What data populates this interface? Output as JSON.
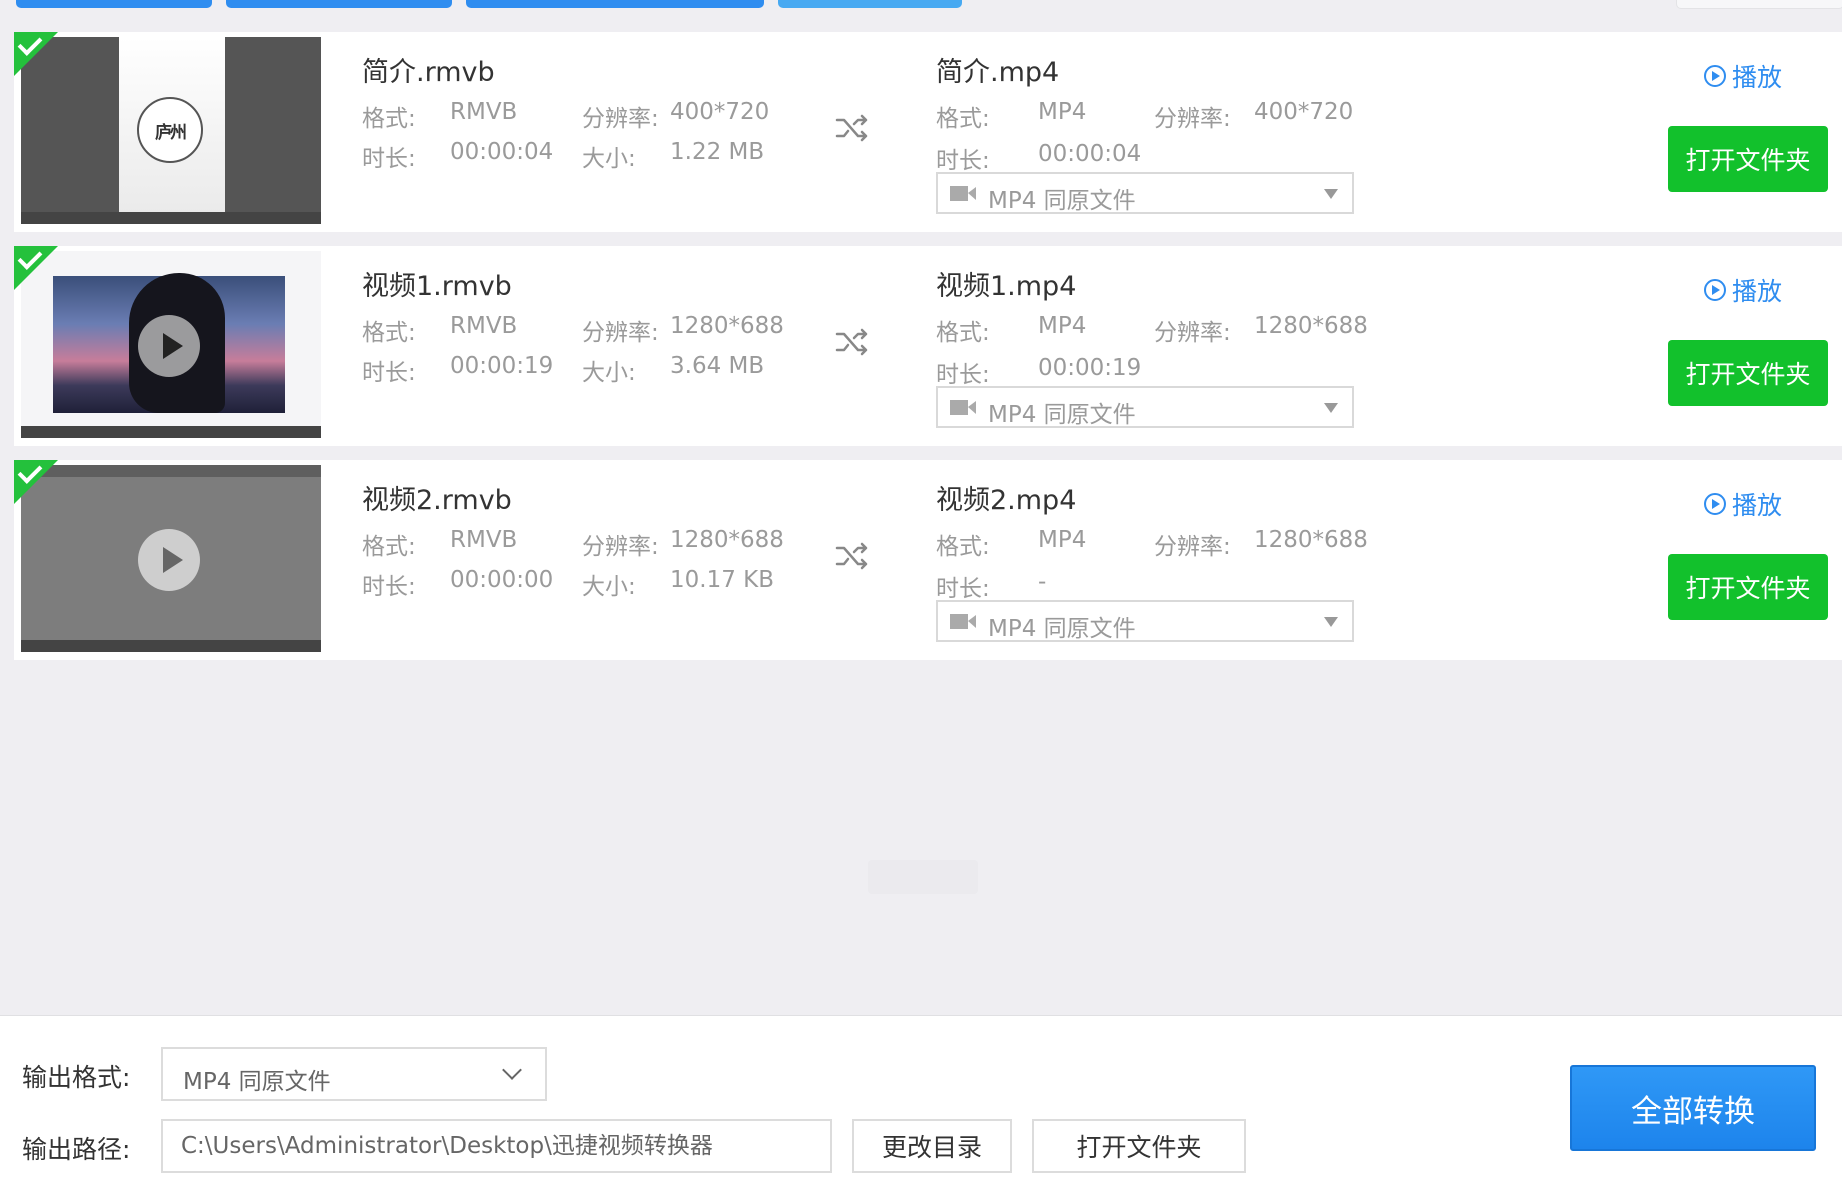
{
  "files": [
    {
      "source_name": "简介.rmvb",
      "format_label": "格式:",
      "source_format": "RMVB",
      "resolution_label": "分辨率:",
      "source_resolution": "400*720",
      "duration_label": "时长:",
      "source_duration": "00:00:04",
      "size_label": "大小:",
      "source_size": "1.22 MB",
      "thumb_text": "庐州",
      "target_name": "简介.mp4",
      "target_format": "MP4",
      "target_resolution": "400*720",
      "target_duration": "00:00:04",
      "output_format": "MP4  同原文件",
      "play_label": "播放",
      "open_folder_label": "打开文件夹"
    },
    {
      "source_name": "视频1.rmvb",
      "format_label": "格式:",
      "source_format": "RMVB",
      "resolution_label": "分辨率:",
      "source_resolution": "1280*688",
      "duration_label": "时长:",
      "source_duration": "00:00:19",
      "size_label": "大小:",
      "source_size": "3.64 MB",
      "target_name": "视频1.mp4",
      "target_format": "MP4",
      "target_resolution": "1280*688",
      "target_duration": "00:00:19",
      "output_format": "MP4  同原文件",
      "play_label": "播放",
      "open_folder_label": "打开文件夹"
    },
    {
      "source_name": "视频2.rmvb",
      "format_label": "格式:",
      "source_format": "RMVB",
      "resolution_label": "分辨率:",
      "source_resolution": "1280*688",
      "duration_label": "时长:",
      "source_duration": "00:00:00",
      "size_label": "大小:",
      "source_size": "10.17 KB",
      "target_name": "视频2.mp4",
      "target_format": "MP4",
      "target_resolution": "1280*688",
      "target_duration": "-",
      "output_format": "MP4  同原文件",
      "play_label": "播放",
      "open_folder_label": "打开文件夹"
    }
  ],
  "bottom": {
    "output_format_label": "输出格式:",
    "output_format_value": "MP4  同原文件",
    "output_path_label": "输出路径:",
    "output_path_value": "C:\\Users\\Administrator\\Desktop\\迅捷视频转换器",
    "change_dir_label": "更改目录",
    "open_folder_label": "打开文件夹",
    "convert_all_label": "全部转换"
  },
  "colors": {
    "accent_blue": "#2f8df0",
    "action_green": "#12c12c",
    "check_green": "#24c13c",
    "background": "#efeef2"
  },
  "icons": [
    "check-icon",
    "shuffle-icon",
    "video-camera-icon",
    "play-circle-icon",
    "chevron-down-icon"
  ]
}
